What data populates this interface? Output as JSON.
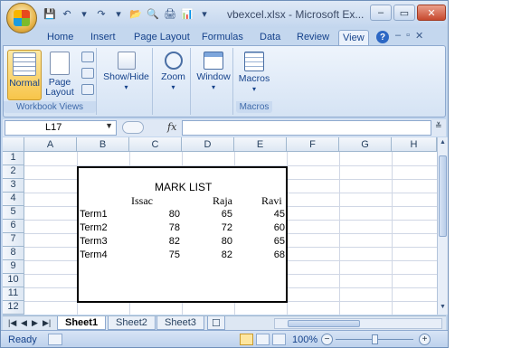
{
  "window": {
    "title": "vbexcel.xlsx - Microsoft Ex..."
  },
  "tabs": [
    {
      "label": "Home"
    },
    {
      "label": "Insert"
    },
    {
      "label": "Page Layout"
    },
    {
      "label": "Formulas"
    },
    {
      "label": "Data"
    },
    {
      "label": "Review"
    },
    {
      "label": "View",
      "active": true
    }
  ],
  "ribbon": {
    "workbook_views": {
      "normal": "Normal",
      "page_layout_1": "Page",
      "page_layout_2": "Layout",
      "label": "Workbook Views"
    },
    "show_hide": "Show/Hide",
    "zoom": "Zoom",
    "window": "Window",
    "macros": "Macros",
    "macros_group": "Macros"
  },
  "formula_bar": {
    "name_box": "L17",
    "fx": "fx",
    "formula": ""
  },
  "columns": [
    "A",
    "B",
    "C",
    "D",
    "E",
    "F",
    "G",
    "H"
  ],
  "rows": [
    "1",
    "2",
    "3",
    "4",
    "5",
    "6",
    "7",
    "8",
    "9",
    "10",
    "11",
    "12"
  ],
  "sheet": {
    "title": "MARK LIST",
    "headers": [
      "Issac",
      "Raja",
      "Ravi"
    ],
    "rows": [
      {
        "term": "Term1",
        "values": [
          "80",
          "65",
          "45"
        ]
      },
      {
        "term": "Term2",
        "values": [
          "78",
          "72",
          "60"
        ]
      },
      {
        "term": "Term3",
        "values": [
          "82",
          "80",
          "65"
        ]
      },
      {
        "term": "Term4",
        "values": [
          "75",
          "82",
          "68"
        ]
      }
    ]
  },
  "sheet_tabs": [
    "Sheet1",
    "Sheet2",
    "Sheet3"
  ],
  "status": {
    "ready": "Ready",
    "zoom": "100%"
  }
}
